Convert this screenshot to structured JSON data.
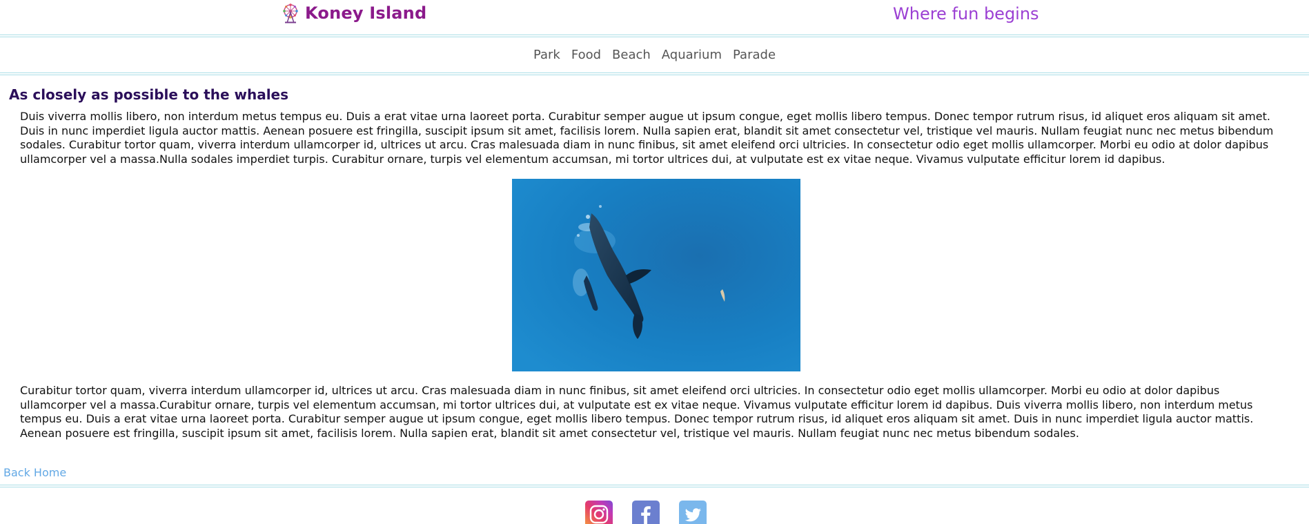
{
  "header": {
    "title": "Koney Island",
    "tagline": "Where fun begins",
    "logo_icon": "ferris-wheel-icon"
  },
  "nav": {
    "items": [
      {
        "label": "Park"
      },
      {
        "label": "Food"
      },
      {
        "label": "Beach"
      },
      {
        "label": "Aquarium"
      },
      {
        "label": "Parade"
      }
    ]
  },
  "main": {
    "title": "As closely as possible to the whales",
    "paragraph1": "Duis viverra mollis libero, non interdum metus tempus eu. Duis a erat vitae urna laoreet porta. Curabitur semper augue ut ipsum congue, eget mollis libero tempus. Donec tempor rutrum risus, id aliquet eros aliquam sit amet. Duis in nunc imperdiet ligula auctor mattis. Aenean posuere est fringilla, suscipit ipsum sit amet, facilisis lorem. Nulla sapien erat, blandit sit amet consectetur vel, tristique vel mauris. Nullam feugiat nunc nec metus bibendum sodales. Curabitur tortor quam, viverra interdum ullamcorper id, ultrices ut arcu. Cras malesuada diam in nunc finibus, sit amet eleifend orci ultricies. In consectetur odio eget mollis ullamcorper. Morbi eu odio at dolor dapibus ullamcorper vel a massa.Nulla sodales imperdiet turpis. Curabitur ornare, turpis vel elementum accumsan, mi tortor ultrices dui, at vulputate est ex vitae neque. Vivamus vulputate efficitur lorem id dapibus.",
    "paragraph2": "Curabitur tortor quam, viverra interdum ullamcorper id, ultrices ut arcu. Cras malesuada diam in nunc finibus, sit amet eleifend orci ultricies. In consectetur odio eget mollis ullamcorper. Morbi eu odio at dolor dapibus ullamcorper vel a massa.Curabitur ornare, turpis vel elementum accumsan, mi tortor ultrices dui, at vulputate est ex vitae neque. Vivamus vulputate efficitur lorem id dapibus. Duis viverra mollis libero, non interdum metus tempus eu. Duis a erat vitae urna laoreet porta. Curabitur semper augue ut ipsum congue, eget mollis libero tempus. Donec tempor rutrum risus, id aliquet eros aliquam sit amet. Duis in nunc imperdiet ligula auctor mattis. Aenean posuere est fringilla, suscipit ipsum sit amet, facilisis lorem. Nulla sapien erat, blandit sit amet consectetur vel, tristique vel mauris. Nullam feugiat nunc nec metus bibendum sodales."
  },
  "back_link": "Back Home",
  "footer": {
    "socials": [
      {
        "icon": "instagram-icon"
      },
      {
        "icon": "facebook-icon"
      },
      {
        "icon": "twitter-icon"
      }
    ]
  },
  "colors": {
    "brand": "#8b1a8b",
    "tagline": "#9b3fd3",
    "heading": "#2b0f5a",
    "rule": "#a9dde6",
    "link": "#62a8e5"
  }
}
